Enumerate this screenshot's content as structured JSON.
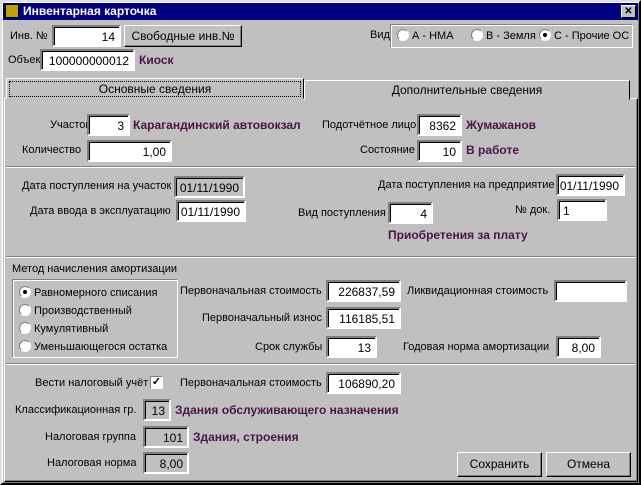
{
  "window": {
    "title": "Инвентарная карточка",
    "close_icon": "close-icon",
    "app_icon": "app-icon"
  },
  "header": {
    "inv_label": "Инв. №",
    "inv_value": "14",
    "free_inv_button": "Свободные инв.№",
    "object_label": "Объект",
    "object_value": "100000000012",
    "object_name": "Киоск",
    "vid_label": "Вид",
    "vid_options": [
      {
        "label": "А - НМА",
        "selected": false
      },
      {
        "label": "В - Земля",
        "selected": false
      },
      {
        "label": "С - Прочие ОС",
        "selected": true
      }
    ]
  },
  "tabs": [
    {
      "label": "Основные сведения",
      "active": true
    },
    {
      "label": "Дополнительные сведения",
      "active": false
    }
  ],
  "main": {
    "uchastok_label": "Участок",
    "uchastok_value": "3",
    "uchastok_name": "Карагандинский автовокзал",
    "person_label": "Подотчётное лицо",
    "person_value": "8362",
    "person_name": "Жумажанов",
    "qty_label": "Количество",
    "qty_value": "1,00",
    "state_label": "Состояние",
    "state_value": "10",
    "state_name": "В работе",
    "date_site_label": "Дата поступления на участок",
    "date_site_value": "01/11/1990",
    "date_ent_label": "Дата поступления на предприятие",
    "date_ent_value": "01/11/1990",
    "date_exp_label": "Дата ввода в эксплуатацию",
    "date_exp_value": "01/11/1990",
    "receipt_label": "Вид поступления",
    "receipt_value": "4",
    "receipt_name": "Приобретения за плату",
    "doc_label": "№ док.",
    "doc_value": "1"
  },
  "amort": {
    "title": "Метод начисления амортизации",
    "methods": [
      {
        "label": "Равномерного списания",
        "selected": true
      },
      {
        "label": "Производственный",
        "selected": false
      },
      {
        "label": "Кумулятивный",
        "selected": false
      },
      {
        "label": "Уменьшающегося остатка",
        "selected": false
      }
    ],
    "init_cost_label": "Первоначальная стоимость",
    "init_cost_value": "226837,59",
    "liq_cost_label": "Ликвидационная стоимость",
    "liq_cost_value": "",
    "init_wear_label": "Первоначальный износ",
    "init_wear_value": "116185,51",
    "life_label": "Срок службы",
    "life_value": "13",
    "rate_label": "Годовая норма амортизации",
    "rate_value": "8,00"
  },
  "tax": {
    "keep_label": "Вести налоговый учёт",
    "keep_checked": true,
    "init_cost_label": "Первоначальная стоимость",
    "init_cost_value": "106890,20",
    "class_label": "Классификационная гр.",
    "class_value": "13",
    "class_name": "Здания обслуживающего назначения",
    "group_label": "Налоговая группа",
    "group_value": "101",
    "group_name": "Здания, строения",
    "norm_label": "Налоговая норма",
    "norm_value": "8,00"
  },
  "buttons": {
    "save": "Сохранить",
    "cancel": "Отмена"
  },
  "colors": {
    "titlebar": "#000080",
    "accent_text": "#4b1448",
    "face": "#c0c0c0"
  }
}
